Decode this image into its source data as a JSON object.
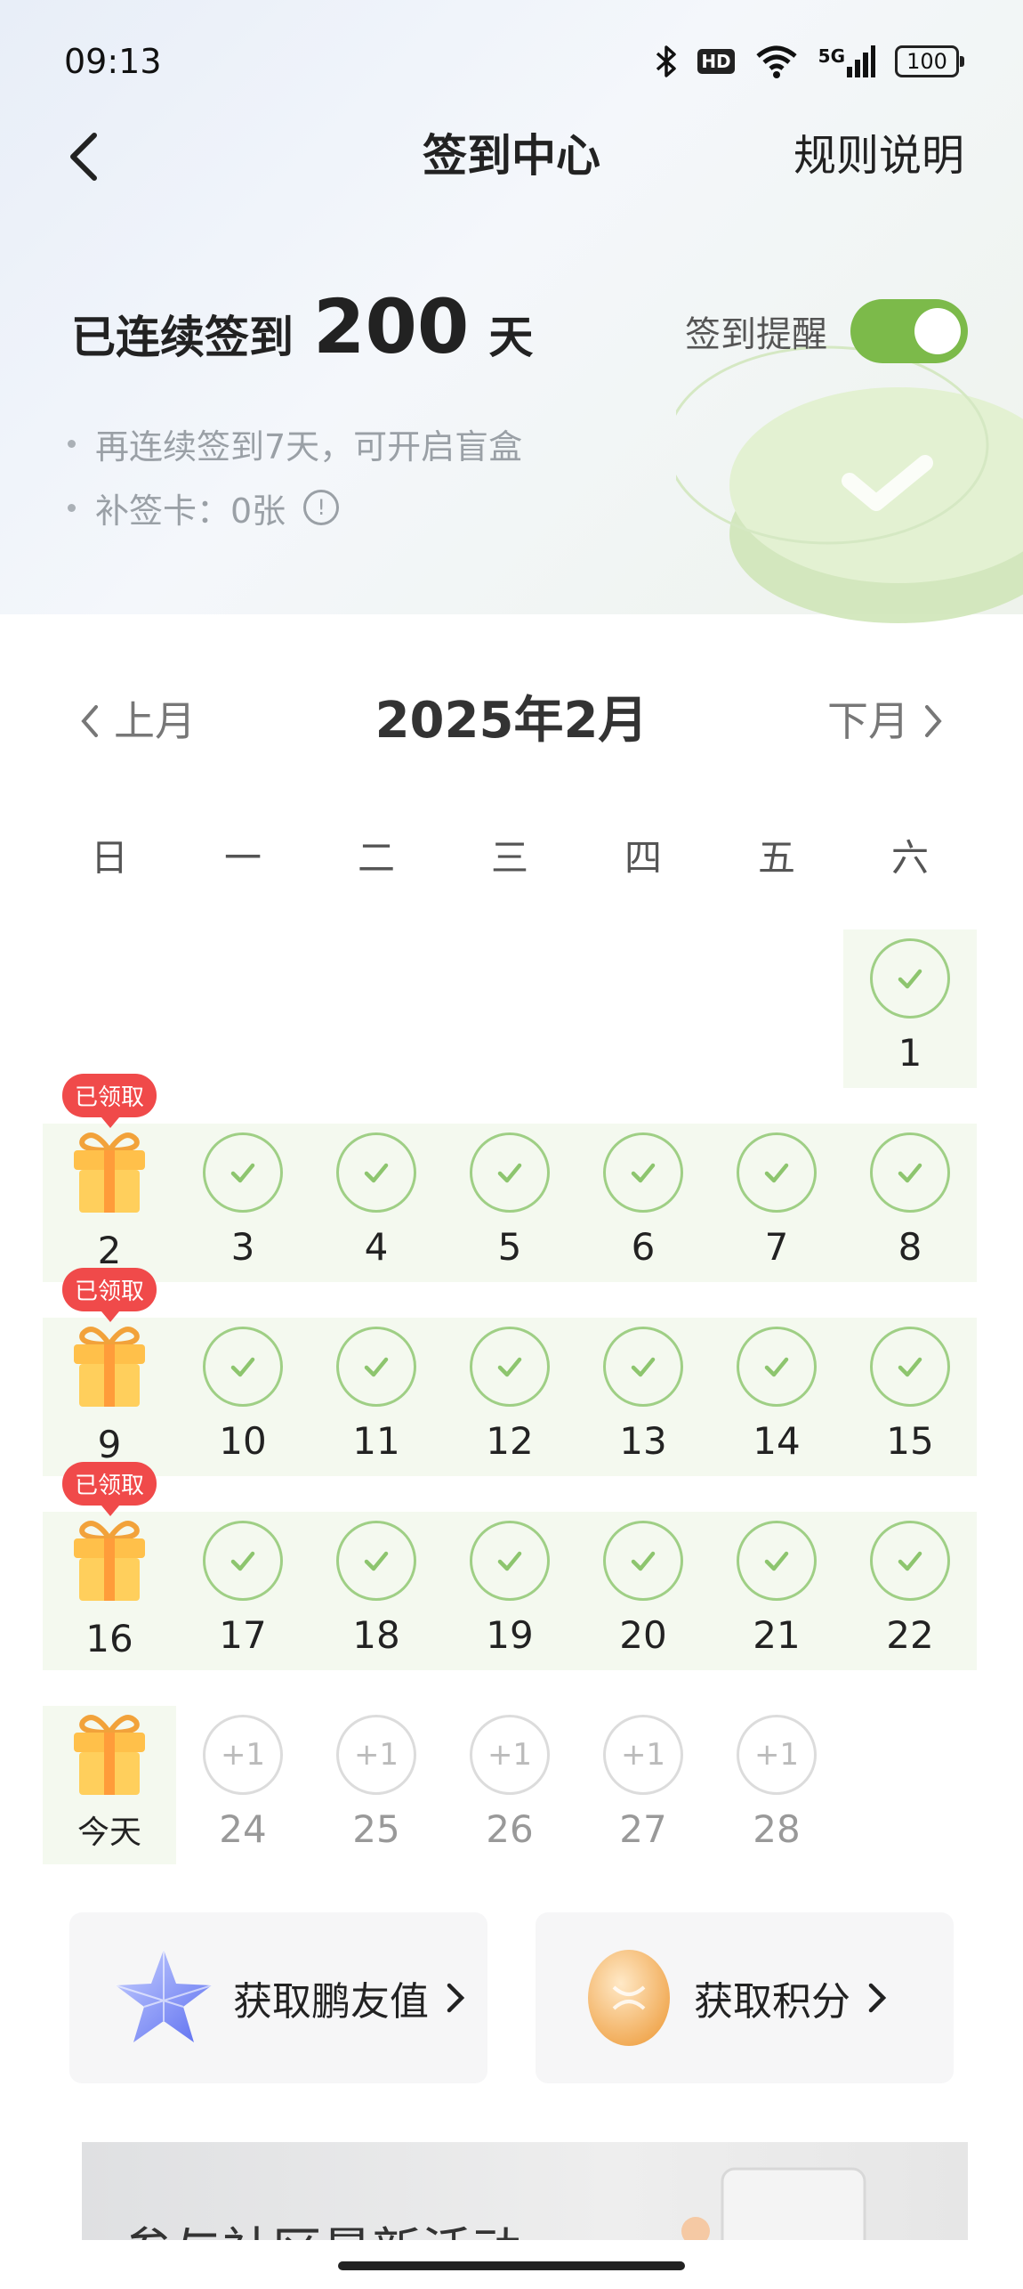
{
  "status_bar": {
    "time": "09:13",
    "hd": "HD",
    "network": "5G",
    "battery": "100"
  },
  "nav": {
    "title": "签到中心",
    "rules": "规则说明"
  },
  "streak": {
    "prefix": "已连续签到",
    "days": "200",
    "suffix": "天"
  },
  "reminder": {
    "label": "签到提醒",
    "enabled": true
  },
  "tips": [
    "再连续签到7天，可开启盲盒",
    "补签卡：0张"
  ],
  "calendar": {
    "prev_label": "上月",
    "next_label": "下月",
    "month": "2025年2月",
    "weekdays": [
      "日",
      "一",
      "二",
      "三",
      "四",
      "五",
      "六"
    ],
    "claimed_badge": "已领取",
    "today_label": "今天",
    "future_bonus": "+1",
    "weeks": [
      [
        "",
        "",
        "",
        "",
        "",
        "",
        "1"
      ],
      [
        "2",
        "3",
        "4",
        "5",
        "6",
        "7",
        "8"
      ],
      [
        "9",
        "10",
        "11",
        "12",
        "13",
        "14",
        "15"
      ],
      [
        "16",
        "17",
        "18",
        "19",
        "20",
        "21",
        "22"
      ],
      [
        "今天",
        "24",
        "25",
        "26",
        "27",
        "28",
        ""
      ]
    ]
  },
  "cards": [
    {
      "label": "获取鹏友值",
      "icon": "star-crystal-icon"
    },
    {
      "label": "获取积分",
      "icon": "gold-coin-icon"
    }
  ],
  "banner": {
    "text": "参与社区最新活动"
  },
  "colors": {
    "accent": "#7cba4a",
    "check": "#9fcf85",
    "badge": "#f04a4a",
    "row_bg": "#f4f9ef"
  }
}
